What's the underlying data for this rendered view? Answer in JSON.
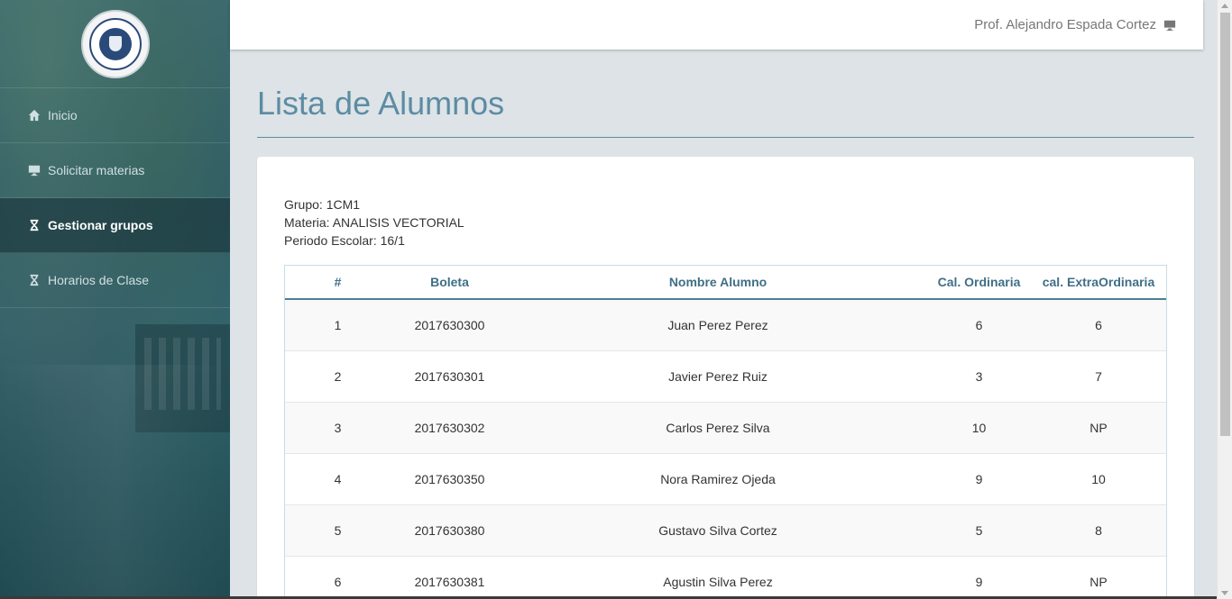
{
  "sidebar": {
    "logo_alt": "STATE UNIVERSITY OF NEW YORK 1948",
    "items": [
      {
        "label": "Inicio",
        "icon": "home-icon",
        "active": false
      },
      {
        "label": "Solicitar materias",
        "icon": "monitor-icon",
        "active": false
      },
      {
        "label": "Gestionar grupos",
        "icon": "hourglass-icon",
        "active": true
      },
      {
        "label": "Horarios de Clase",
        "icon": "hourglass-icon",
        "active": false
      }
    ]
  },
  "header": {
    "user_name": "Prof. Alejandro Espada Cortez",
    "user_icon": "monitor-icon"
  },
  "page": {
    "title": "Lista de Alumnos"
  },
  "group_info": {
    "grupo": "Grupo: 1CM1",
    "materia": "Materia: ANALISIS VECTORIAL",
    "periodo": "Periodo Escolar: 16/1"
  },
  "table": {
    "headers": [
      "#",
      "Boleta",
      "Nombre Alumno",
      "Cal. Ordinaria",
      "cal. ExtraOrdinaria"
    ],
    "rows": [
      [
        "1",
        "2017630300",
        "Juan Perez Perez",
        "6",
        "6"
      ],
      [
        "2",
        "2017630301",
        "Javier Perez Ruiz",
        "3",
        "7"
      ],
      [
        "3",
        "2017630302",
        "Carlos Perez Silva",
        "10",
        "NP"
      ],
      [
        "4",
        "2017630350",
        "Nora Ramirez Ojeda",
        "9",
        "10"
      ],
      [
        "5",
        "2017630380",
        "Gustavo Silva Cortez",
        "5",
        "8"
      ],
      [
        "6",
        "2017630381",
        "Agustin Silva Perez",
        "9",
        "NP"
      ]
    ]
  },
  "colors": {
    "accent": "#5d8ca4",
    "sidebar_bg": "#2f5e66",
    "header_text": "#3f6f86"
  }
}
